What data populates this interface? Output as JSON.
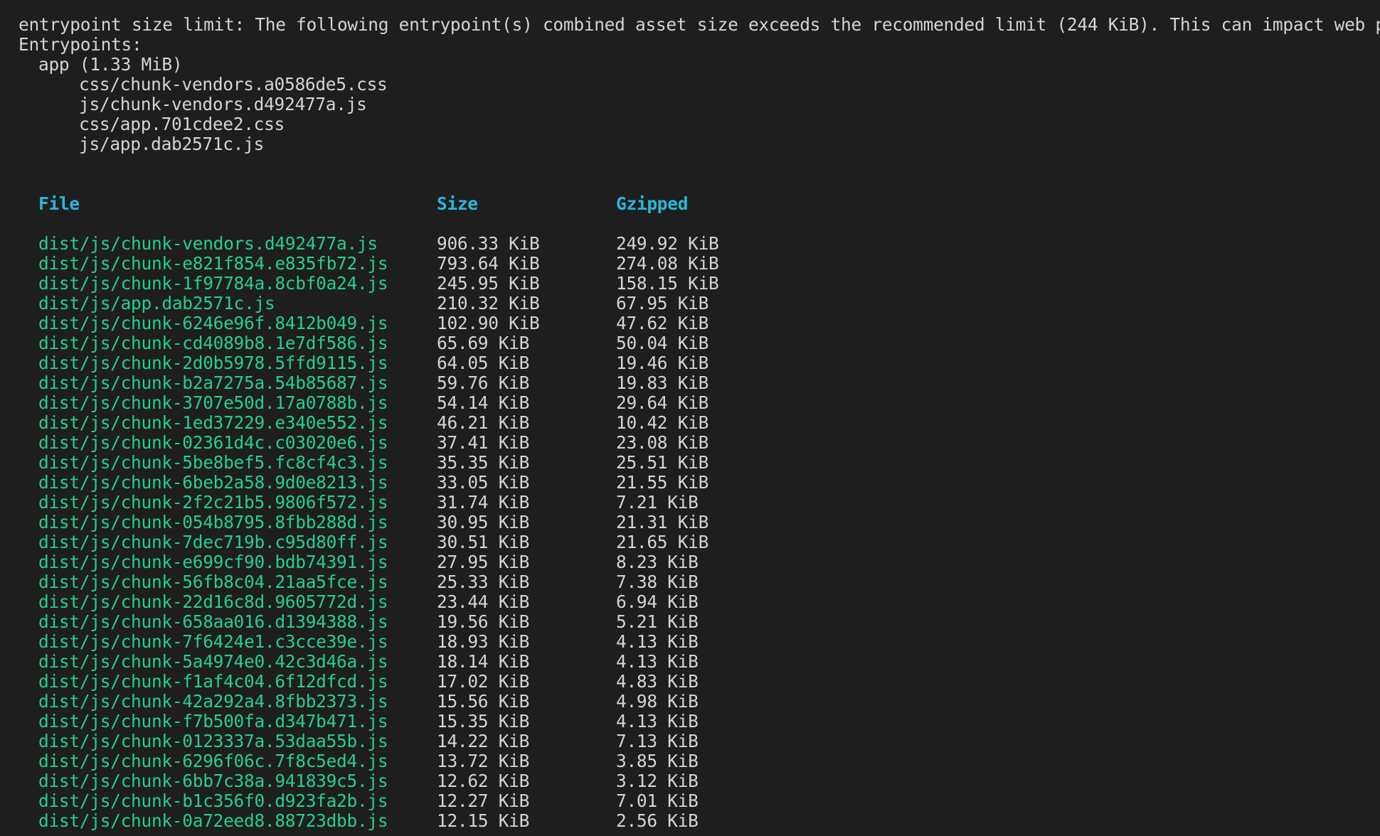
{
  "warning": {
    "message": "entrypoint size limit: The following entrypoint(s) combined asset size exceeds the recommended limit (244 KiB). This can impact web perfo",
    "entrypoints_label": "Entrypoints:",
    "entry_name": "app (1.33 MiB)",
    "entry_files": [
      "css/chunk-vendors.a0586de5.css",
      "js/chunk-vendors.d492477a.js",
      "css/app.701cdee2.css",
      "js/app.dab2571c.js"
    ]
  },
  "table": {
    "headers": {
      "file": "File",
      "size": "Size",
      "gzipped": "Gzipped"
    },
    "rows": [
      {
        "file": "dist/js/chunk-vendors.d492477a.js",
        "size": "906.33 KiB",
        "gzipped": "249.92 KiB"
      },
      {
        "file": "dist/js/chunk-e821f854.e835fb72.js",
        "size": "793.64 KiB",
        "gzipped": "274.08 KiB"
      },
      {
        "file": "dist/js/chunk-1f97784a.8cbf0a24.js",
        "size": "245.95 KiB",
        "gzipped": "158.15 KiB"
      },
      {
        "file": "dist/js/app.dab2571c.js",
        "size": "210.32 KiB",
        "gzipped": "67.95 KiB"
      },
      {
        "file": "dist/js/chunk-6246e96f.8412b049.js",
        "size": "102.90 KiB",
        "gzipped": "47.62 KiB"
      },
      {
        "file": "dist/js/chunk-cd4089b8.1e7df586.js",
        "size": "65.69 KiB",
        "gzipped": "50.04 KiB"
      },
      {
        "file": "dist/js/chunk-2d0b5978.5ffd9115.js",
        "size": "64.05 KiB",
        "gzipped": "19.46 KiB"
      },
      {
        "file": "dist/js/chunk-b2a7275a.54b85687.js",
        "size": "59.76 KiB",
        "gzipped": "19.83 KiB"
      },
      {
        "file": "dist/js/chunk-3707e50d.17a0788b.js",
        "size": "54.14 KiB",
        "gzipped": "29.64 KiB"
      },
      {
        "file": "dist/js/chunk-1ed37229.e340e552.js",
        "size": "46.21 KiB",
        "gzipped": "10.42 KiB"
      },
      {
        "file": "dist/js/chunk-02361d4c.c03020e6.js",
        "size": "37.41 KiB",
        "gzipped": "23.08 KiB"
      },
      {
        "file": "dist/js/chunk-5be8bef5.fc8cf4c3.js",
        "size": "35.35 KiB",
        "gzipped": "25.51 KiB"
      },
      {
        "file": "dist/js/chunk-6beb2a58.9d0e8213.js",
        "size": "33.05 KiB",
        "gzipped": "21.55 KiB"
      },
      {
        "file": "dist/js/chunk-2f2c21b5.9806f572.js",
        "size": "31.74 KiB",
        "gzipped": "7.21 KiB"
      },
      {
        "file": "dist/js/chunk-054b8795.8fbb288d.js",
        "size": "30.95 KiB",
        "gzipped": "21.31 KiB"
      },
      {
        "file": "dist/js/chunk-7dec719b.c95d80ff.js",
        "size": "30.51 KiB",
        "gzipped": "21.65 KiB"
      },
      {
        "file": "dist/js/chunk-e699cf90.bdb74391.js",
        "size": "27.95 KiB",
        "gzipped": "8.23 KiB"
      },
      {
        "file": "dist/js/chunk-56fb8c04.21aa5fce.js",
        "size": "25.33 KiB",
        "gzipped": "7.38 KiB"
      },
      {
        "file": "dist/js/chunk-22d16c8d.9605772d.js",
        "size": "23.44 KiB",
        "gzipped": "6.94 KiB"
      },
      {
        "file": "dist/js/chunk-658aa016.d1394388.js",
        "size": "19.56 KiB",
        "gzipped": "5.21 KiB"
      },
      {
        "file": "dist/js/chunk-7f6424e1.c3cce39e.js",
        "size": "18.93 KiB",
        "gzipped": "4.13 KiB"
      },
      {
        "file": "dist/js/chunk-5a4974e0.42c3d46a.js",
        "size": "18.14 KiB",
        "gzipped": "4.13 KiB"
      },
      {
        "file": "dist/js/chunk-f1af4c04.6f12dfcd.js",
        "size": "17.02 KiB",
        "gzipped": "4.83 KiB"
      },
      {
        "file": "dist/js/chunk-42a292a4.8fbb2373.js",
        "size": "15.56 KiB",
        "gzipped": "4.98 KiB"
      },
      {
        "file": "dist/js/chunk-f7b500fa.d347b471.js",
        "size": "15.35 KiB",
        "gzipped": "4.13 KiB"
      },
      {
        "file": "dist/js/chunk-0123337a.53daa55b.js",
        "size": "14.22 KiB",
        "gzipped": "7.13 KiB"
      },
      {
        "file": "dist/js/chunk-6296f06c.7f8c5ed4.js",
        "size": "13.72 KiB",
        "gzipped": "3.85 KiB"
      },
      {
        "file": "dist/js/chunk-6bb7c38a.941839c5.js",
        "size": "12.62 KiB",
        "gzipped": "3.12 KiB"
      },
      {
        "file": "dist/js/chunk-b1c356f0.d923fa2b.js",
        "size": "12.27 KiB",
        "gzipped": "7.01 KiB"
      },
      {
        "file": "dist/js/chunk-0a72eed8.88723dbb.js",
        "size": "12.15 KiB",
        "gzipped": "2.56 KiB"
      }
    ]
  },
  "colors": {
    "background": "#1e1e1e",
    "text": "#d4d4d4",
    "header": "#29b8db",
    "file": "#23d18b"
  }
}
